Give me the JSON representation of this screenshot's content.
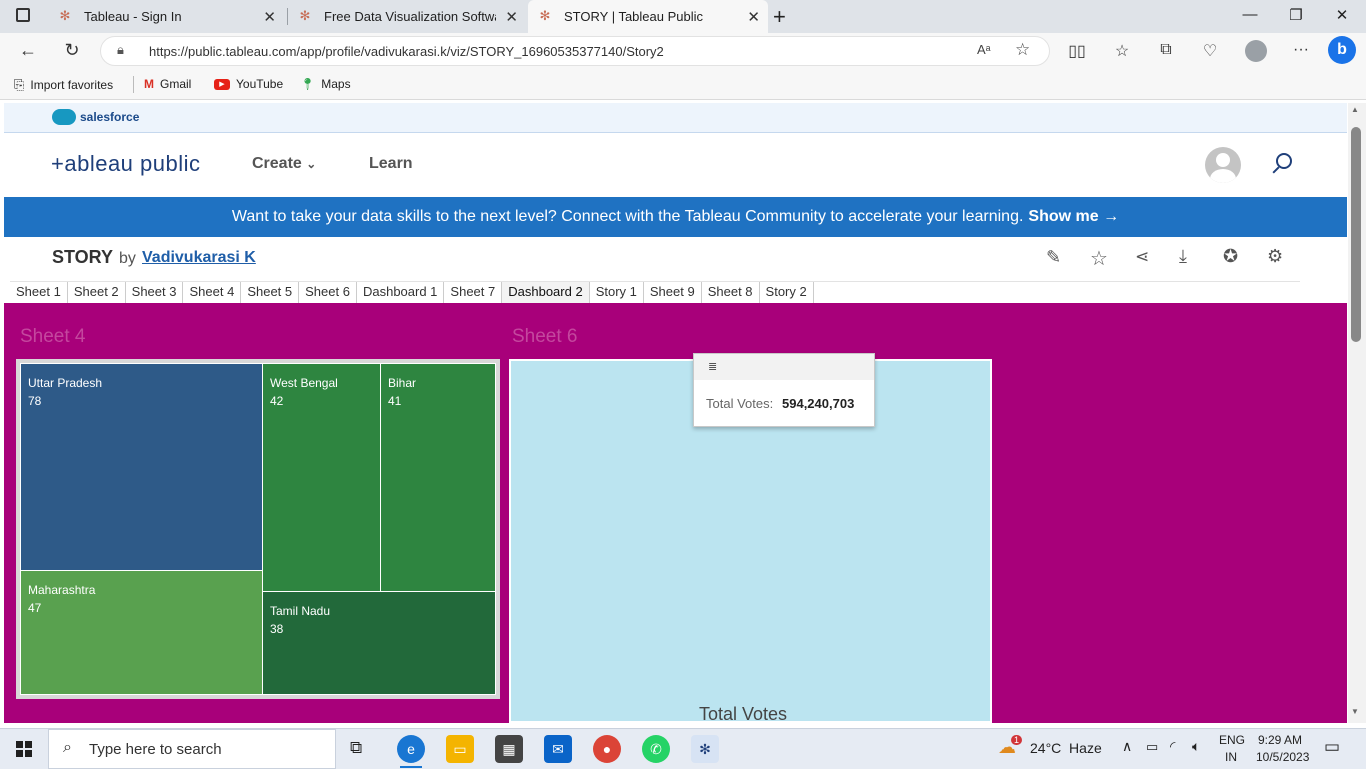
{
  "browser": {
    "tabs": [
      {
        "title": "Tableau - Sign In"
      },
      {
        "title": "Free Data Visualization Software"
      },
      {
        "title": "STORY | Tableau Public"
      }
    ],
    "url": "https://public.tableau.com/app/profile/vadivukarasi.k/viz/STORY_16960535377140/Story2",
    "favorites": [
      "Import favorites",
      "Gmail",
      "YouTube",
      "Maps"
    ]
  },
  "site": {
    "salesforce_label": "salesforce",
    "logo_text": "+ableau public",
    "nav": [
      {
        "label": "Create"
      },
      {
        "label": "Learn"
      }
    ],
    "banner_text": "Want to take your data skills to the next level? Connect with the Tableau Community to accelerate your learning.",
    "banner_link": "Show me →"
  },
  "viz": {
    "title": "STORY",
    "by": "by",
    "author": "Vadivukarasi K",
    "tabs": [
      "Sheet 1",
      "Sheet 2",
      "Sheet 3",
      "Sheet 4",
      "Sheet 5",
      "Sheet 6",
      "Dashboard 1",
      "Sheet 7",
      "Dashboard 2",
      "Story 1",
      "Sheet 9",
      "Sheet 8",
      "Story 2"
    ],
    "selected_tab": "Dashboard 2",
    "sheet4": {
      "title": "Sheet 4",
      "cells": [
        {
          "state": "Uttar Pradesh",
          "value": "78",
          "color": "#2e5a88"
        },
        {
          "state": "West Bengal",
          "value": "42",
          "color": "#2e8540"
        },
        {
          "state": "Bihar",
          "value": "41",
          "color": "#2e8540"
        },
        {
          "state": "Maharashtra",
          "value": "47",
          "color": "#59a14f"
        },
        {
          "state": "Tamil Nadu",
          "value": "38",
          "color": "#22693a"
        }
      ]
    },
    "sheet6": {
      "title": "Sheet 6",
      "tooltip_label": "Total Votes:",
      "tooltip_value": "594,240,703",
      "footer_label": "Total Votes",
      "color": "#bbe4f0"
    }
  },
  "taskbar": {
    "search_placeholder": "Type here to search",
    "weather": "24°C  Haze",
    "lang1": "ENG",
    "lang2": "IN",
    "time": "9:29 AM",
    "date": "10/5/2023",
    "weather_badge": "1"
  }
}
